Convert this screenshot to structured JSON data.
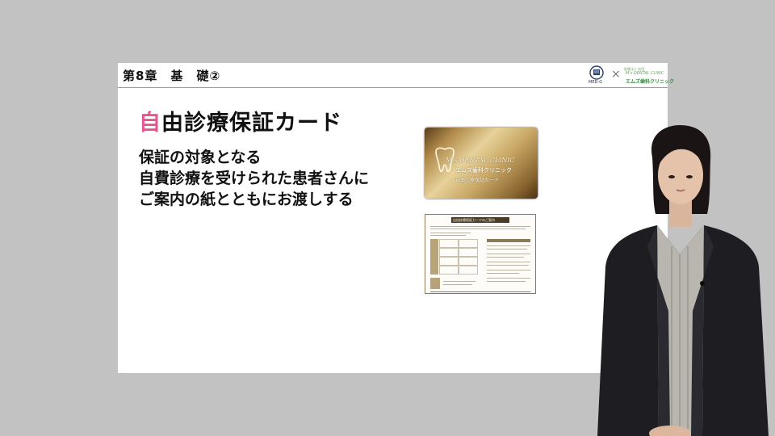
{
  "slide": {
    "chapter_title": "第8章　基　礎②",
    "heading_first_char": "自",
    "heading_rest": "由診療保証カード",
    "body_lines": [
      "保証の対象となる",
      "自費診療を受けられた患者さんに",
      "ご案内の紙とともにお渡しする"
    ]
  },
  "logos": {
    "med_logo_text": "MED-G",
    "cross": "×",
    "clinic_logo_top": "医療法人 社団",
    "clinic_logo_mid": "M's DENTAL CLINIC",
    "clinic_logo_bot": "エムズ歯科クリニック"
  },
  "card": {
    "clinic_en": "M's DENTAL CLINIC",
    "clinic_jp": "エムズ歯科クリニック",
    "subtitle": "自由診療保証カード"
  },
  "document": {
    "title": "自由診療保証カードのご案内"
  },
  "colors": {
    "background": "#c2c2c2",
    "slide": "#ffffff",
    "heading_accent": "#e8568f",
    "text": "#111111"
  }
}
